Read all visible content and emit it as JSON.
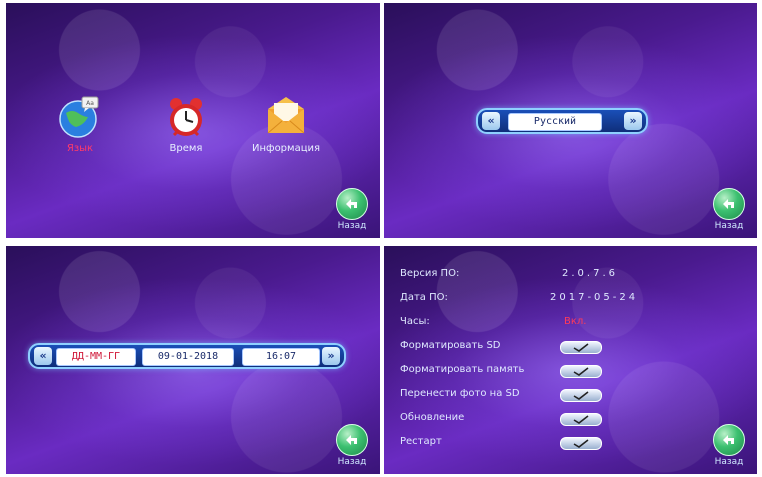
{
  "panel1": {
    "items": [
      {
        "label": "Язык",
        "color": "#ff3a6a"
      },
      {
        "label": "Время",
        "color": "#e8f0ff"
      },
      {
        "label": "Информация",
        "color": "#e8f0ff"
      }
    ],
    "back_label": "Назад"
  },
  "panel2": {
    "language_value": "Русский",
    "back_label": "Назад"
  },
  "panel3": {
    "date_format": "ДД-ММ-ГГ",
    "date_value": "09-01-2018",
    "time_value": "16:07",
    "back_label": "Назад"
  },
  "panel4": {
    "rows": [
      {
        "label": "Версия ПО:",
        "value": "2.0.7.6"
      },
      {
        "label": "Дата ПО:",
        "value": "2017-05-24"
      },
      {
        "label": "Часы:",
        "value": "Вкл."
      },
      {
        "label": "Форматировать SD"
      },
      {
        "label": "Форматировать память"
      },
      {
        "label": "Перенести фото на SD"
      },
      {
        "label": "Обновление"
      },
      {
        "label": "Рестарт"
      }
    ],
    "back_label": "Назад"
  },
  "colors": {
    "accent": "#8fd0ff",
    "warn": "#ff3a5a"
  }
}
